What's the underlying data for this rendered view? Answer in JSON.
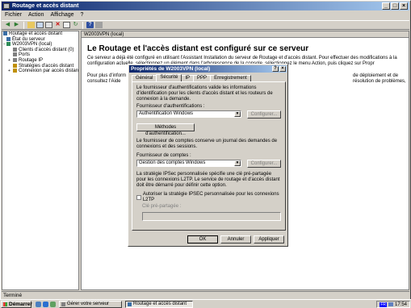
{
  "window": {
    "title": "Routage et accès distant"
  },
  "menu": {
    "items": [
      "Fichier",
      "Action",
      "Affichage",
      "?"
    ]
  },
  "tree": {
    "items": [
      {
        "label": "Routage et accès distant",
        "indent": 0,
        "icon_color": "#3a6ea5"
      },
      {
        "label": "État du serveur",
        "indent": 1,
        "icon_color": "#3a6ea5"
      },
      {
        "label": "W2003VPN (local)",
        "indent": 1,
        "icon_color": "#2e8b57"
      },
      {
        "label": "Clients d'accès distant (0)",
        "indent": 2,
        "icon_color": "#808080"
      },
      {
        "label": "Ports",
        "indent": 2,
        "icon_color": "#808080"
      },
      {
        "label": "Routage IP",
        "indent": 2,
        "icon_color": "#808080"
      },
      {
        "label": "Stratégies d'accès distant",
        "indent": 2,
        "icon_color": "#c09000"
      },
      {
        "label": "Connexion par accès distan",
        "indent": 2,
        "icon_color": "#c09000"
      }
    ]
  },
  "right": {
    "header": "W2003VPN (local)",
    "title": "Le Routage et l'accès distant est configuré sur ce serveur",
    "text1": "Ce serveur a déjà été configuré en utilisant l'Assistant Installation du serveur de Routage et d'accès distant. Pour effectuer des modifications à la configuration actuelle, sélectionnez un élément dans l'arborescence de la console, sélectionnez le menu Action, puis cliquez sur Propr",
    "text2": "Pour plus d'inform consultez l'Aide",
    "text3": "de déploiement et de résolution de problèmes,"
  },
  "status": {
    "text": "Terminé"
  },
  "taskbar": {
    "start": "Démarrer",
    "tasks": [
      "Gérer votre serveur",
      "Routage et accès distant"
    ],
    "lang": "FR",
    "time": "17:54"
  },
  "dialog": {
    "title": "Propriétés de W2003VPN (local)",
    "tabs": [
      "Général",
      "Sécurité",
      "IP",
      "PPP",
      "Enregistrement"
    ],
    "active_tab": "Sécurité",
    "auth_desc": "Le fournisseur d'authentifications valide les informations d'identification pour les clients d'accès distant et les routeurs de connexion à la demande.",
    "auth_label": "Fournisseur d'authentifications :",
    "auth_value": "Authentification Windows",
    "configure_label": "Configurer...",
    "auth_methods": "Méthodes d'authentification...",
    "acct_desc": "Le fournisseur de comptes conserve un journal des demandes de connexions et des sessions.",
    "acct_label": "Fournisseur de comptes :",
    "acct_value": "Gestion des comptes Windows",
    "ipsec_desc": "La stratégie IPSec personnalisée spécifie une clé pré-partagée pour les connexions L2TP. Le service de routage et d'accès distant doit être démarré pour définir cette option.",
    "ipsec_check": "Autoriser la stratégie IPSEC personnalisée pour les connexions L2TP",
    "psk_label": "Clé pré-partagée :",
    "ok": "OK",
    "cancel": "Annuler",
    "apply": "Appliquer"
  }
}
